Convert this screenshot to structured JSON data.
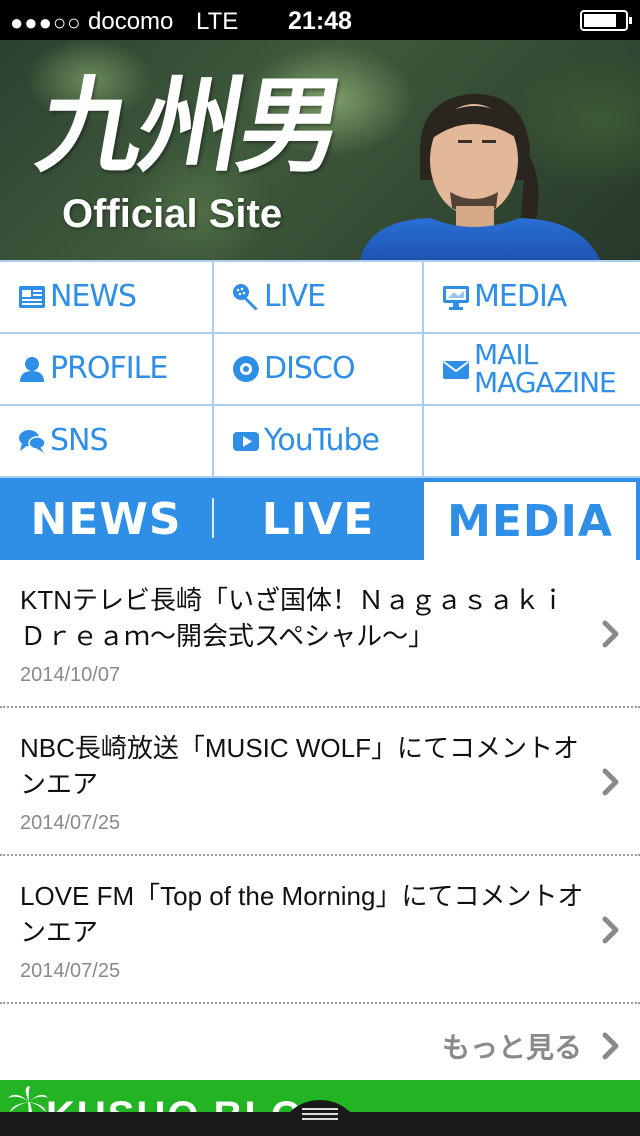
{
  "status_bar": {
    "signal": "●●●○○",
    "carrier": "docomo",
    "network": "LTE",
    "time": "21:48"
  },
  "hero": {
    "logo_text": "九州男",
    "subtitle": "Official Site"
  },
  "nav": {
    "items": [
      {
        "label": "NEWS",
        "icon": "newspaper-icon"
      },
      {
        "label": "LIVE",
        "icon": "microphone-icon"
      },
      {
        "label": "MEDIA",
        "icon": "monitor-icon"
      },
      {
        "label": "PROFILE",
        "icon": "person-icon"
      },
      {
        "label": "DISCO",
        "icon": "disc-icon"
      },
      {
        "label": "MAIL",
        "label2": "MAGAZINE",
        "icon": "envelope-icon"
      },
      {
        "label": "SNS",
        "icon": "speech-bubbles-icon"
      },
      {
        "label": "YouTube",
        "icon": "play-icon"
      }
    ],
    "accent_color": "#2f8ee6"
  },
  "tabs": {
    "items": [
      "NEWS",
      "LIVE",
      "MEDIA"
    ],
    "active": "MEDIA"
  },
  "list": {
    "items": [
      {
        "title": "KTNテレビ長崎「いざ国体！ＮａｇａｓａｋｉＤｒｅａｍ〜開会式スペシャル〜」",
        "date": "2014/10/07"
      },
      {
        "title": "NBC長崎放送「MUSIC WOLF」にてコメントオンエア",
        "date": "2014/07/25"
      },
      {
        "title": "LOVE FM「Top of the Morning」にてコメントオンエア",
        "date": "2014/07/25"
      }
    ],
    "more_label": "もっと見る"
  },
  "banner": {
    "label": "KUSUO BLOG",
    "color": "#22b422"
  }
}
